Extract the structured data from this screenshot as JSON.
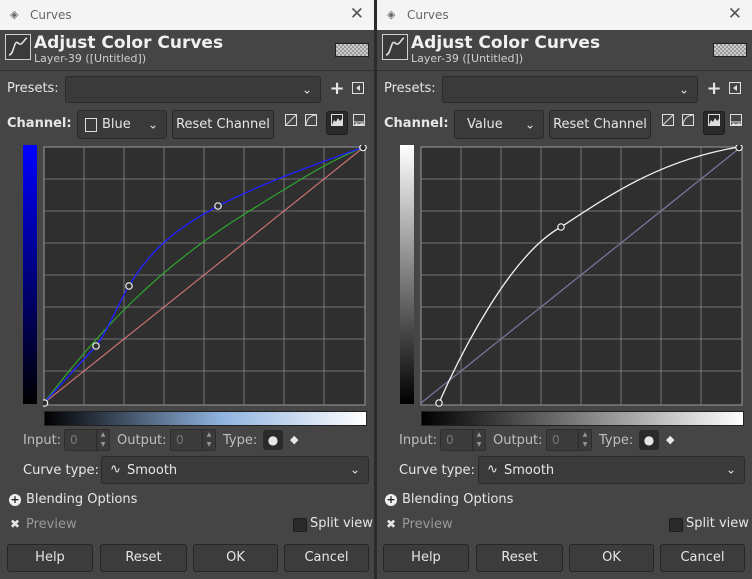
{
  "windows": [
    {
      "id": "left",
      "window_title": "Curves",
      "dialog_title": "Adjust Color Curves",
      "layer_label": "Layer-39 ([Untitled])",
      "presets_label": "Presets:",
      "presets_value": "",
      "channel_label": "Channel:",
      "channel_value": "Blue",
      "reset_channel_label": "Reset Channel",
      "input_label": "Input:",
      "input_value": "0",
      "output_label": "Output:",
      "output_value": "0",
      "type_label": "Type:",
      "curve_type_label": "Curve type:",
      "curve_type_value": "Smooth",
      "blending_label": "Blending Options",
      "preview_label": "Preview",
      "split_view_label": "Split view",
      "buttons": {
        "help": "Help",
        "reset": "Reset",
        "ok": "OK",
        "cancel": "Cancel"
      },
      "curve_color": "#2222ff",
      "channel_color": "#0000ff"
    },
    {
      "id": "right",
      "window_title": "Curves",
      "dialog_title": "Adjust Color Curves",
      "layer_label": "Layer-39 ([Untitled])",
      "presets_label": "Presets:",
      "presets_value": "",
      "channel_label": "Channel:",
      "channel_value": "Value",
      "reset_channel_label": "Reset Channel",
      "input_label": "Input:",
      "input_value": "0",
      "output_label": "Output:",
      "output_value": "0",
      "type_label": "Type:",
      "curve_type_label": "Curve type:",
      "curve_type_value": "Smooth",
      "blending_label": "Blending Options",
      "preview_label": "Preview",
      "split_view_label": "Split view",
      "buttons": {
        "help": "Help",
        "reset": "Reset",
        "ok": "OK",
        "cancel": "Cancel"
      },
      "curve_color": "#f0f0f0",
      "channel_color": "#ffffff"
    }
  ]
}
